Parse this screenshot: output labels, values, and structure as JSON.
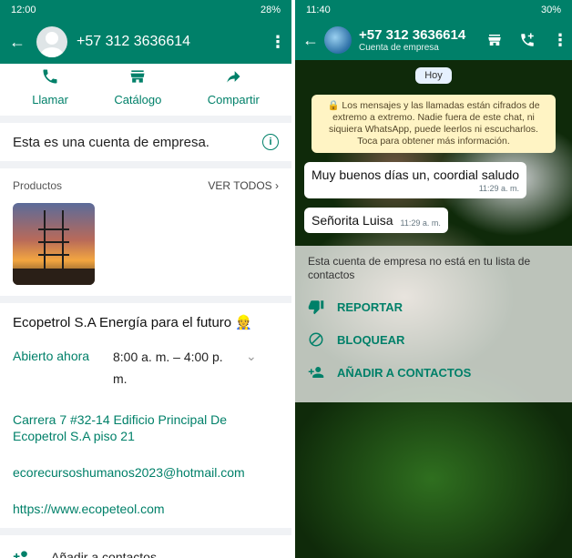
{
  "left": {
    "status": {
      "time": "12:00",
      "battery": "28%"
    },
    "header": {
      "title": "+57 312 3636614"
    },
    "actions": [
      {
        "label": "Llamar",
        "icon": "phone-icon"
      },
      {
        "label": "Catálogo",
        "icon": "store-icon"
      },
      {
        "label": "Compartir",
        "icon": "share-icon"
      }
    ],
    "business_note": "Esta es una cuenta de empresa.",
    "products": {
      "title": "Productos",
      "see_all": "VER TODOS ›"
    },
    "profile": {
      "name": "Ecopetrol S.A Energía para el futuro 👷",
      "open_label": "Abierto ahora",
      "hours": "8:00 a. m. – 4:00 p. m.",
      "address": "Carrera 7 #32-14 Edificio Principal De Ecopetrol S.A piso 21",
      "email": "ecorecursoshumanos2023@hotmail.com",
      "website": "https://www.ecopeteol.com"
    },
    "bottom": {
      "label": "Añadir a contactos"
    }
  },
  "right": {
    "status": {
      "time": "11:40",
      "battery": "30%"
    },
    "header": {
      "title": "+57 312 3636614",
      "subtitle": "Cuenta de empresa"
    },
    "date_pill": "Hoy",
    "encryption": "🔒 Los mensajes y las llamadas están cifrados de extremo a extremo. Nadie fuera de este chat, ni siquiera WhatsApp, puede leerlos ni escucharlos. Toca para obtener más información.",
    "messages": [
      {
        "text": "Muy buenos días un, coordial saludo",
        "time": "11:29 a. m."
      },
      {
        "text": "Señorita Luisa",
        "time": "11:29 a. m."
      }
    ],
    "notice": {
      "text": "Esta cuenta de empresa no está en tu lista de contactos",
      "options": [
        {
          "label": "REPORTAR",
          "icon": "thumbs-down-icon"
        },
        {
          "label": "BLOQUEAR",
          "icon": "block-icon"
        },
        {
          "label": "AÑADIR A CONTACTOS",
          "icon": "add-person-icon"
        }
      ]
    }
  },
  "colors": {
    "accent": "#008069",
    "encryption_bg": "#fff4c4"
  }
}
